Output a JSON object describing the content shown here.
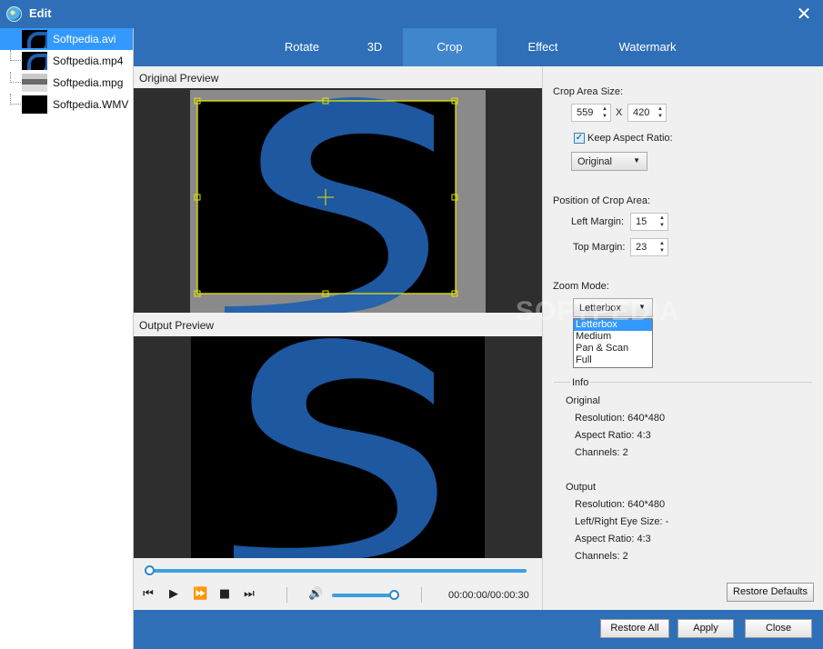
{
  "window": {
    "title": "Edit",
    "close_glyph": "✕"
  },
  "files": [
    {
      "name": "Softpedia.avi",
      "selected": true
    },
    {
      "name": "Softpedia.mp4",
      "selected": false
    },
    {
      "name": "Softpedia.mpg",
      "selected": false
    },
    {
      "name": "Softpedia.WMV",
      "selected": false
    }
  ],
  "tabs": [
    "Rotate",
    "3D",
    "Crop",
    "Effect",
    "Watermark"
  ],
  "active_tab": "Crop",
  "previews": {
    "original_label": "Original Preview",
    "output_label": "Output Preview"
  },
  "crop": {
    "area_label": "Crop Area Size:",
    "width": "559",
    "height": "420",
    "x_sep": "X",
    "keep_aspect_label": "Keep Aspect Ratio:",
    "keep_aspect_checked": true,
    "aspect_value": "Original",
    "position_label": "Position of Crop Area:",
    "left_margin_label": "Left Margin:",
    "left_margin": "15",
    "top_margin_label": "Top Margin:",
    "top_margin": "23",
    "zoom_label": "Zoom Mode:",
    "zoom_value": "Letterbox",
    "zoom_options": [
      "Letterbox",
      "Medium",
      "Pan & Scan",
      "Full"
    ]
  },
  "info": {
    "title": "Info",
    "original_heading": "Original",
    "original_resolution": "Resolution: 640*480",
    "original_aspect": "Aspect Ratio: 4:3",
    "original_channels": "Channels: 2",
    "output_heading": "Output",
    "output_resolution": "Resolution: 640*480",
    "output_eye": "Left/Right Eye Size: -",
    "output_aspect": "Aspect Ratio: 4:3",
    "output_channels": "Channels: 2"
  },
  "buttons": {
    "restore_defaults": "Restore Defaults",
    "restore_all": "Restore All",
    "apply": "Apply",
    "close": "Close"
  },
  "player": {
    "time": "00:00:00/00:00:30",
    "progress": 0.0,
    "volume": 0.9
  },
  "watermark_text": "SOFTPEDIA",
  "colors": {
    "accent": "#2f6fb8",
    "selection": "#3399ff",
    "crop_frame": "#e5e500",
    "logo_blue": "#1f5fae"
  }
}
